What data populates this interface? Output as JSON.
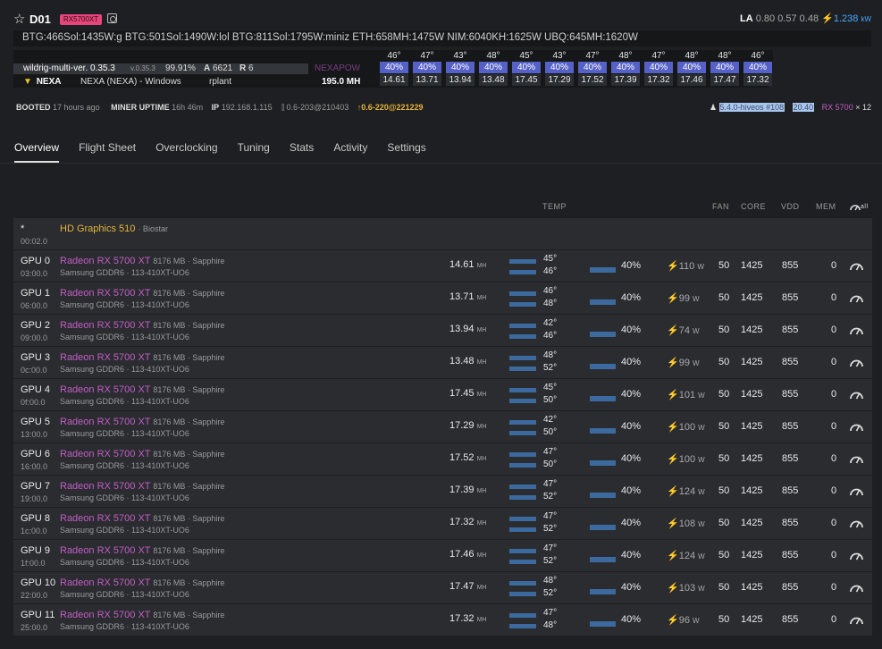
{
  "header": {
    "name": "D01",
    "tag": "RX5700XT",
    "la_label": "LA",
    "la_values": "0.80 0.57 0.48",
    "power": "1.238",
    "power_unit": "kW"
  },
  "algos": "BTG:466Sol:1435W:g BTG:501Sol:1490W:lol BTG:811Sol:1795W:miniz ETH:658MH:1475W NIM:6040KH:1625W UBQ:645MH:1620W",
  "miner": {
    "name": "wildrig-multi-ver. 0.35.3",
    "ver": "v.0.35.3",
    "accept": "99.91%",
    "a_label": "A",
    "a": "6621",
    "r_label": "R",
    "r": "6",
    "coin": "NEXA",
    "pool": "NEXA (NEXA) - Windows",
    "pool_host": "rplant",
    "algo": "NEXAPOW",
    "hashrate": "195.0 MH"
  },
  "gpu_strip": [
    {
      "t": "46°",
      "f": "40%",
      "h": "14.61"
    },
    {
      "t": "47°",
      "f": "40%",
      "h": "13.71"
    },
    {
      "t": "43°",
      "f": "40%",
      "h": "13.94"
    },
    {
      "t": "48°",
      "f": "40%",
      "h": "13.48"
    },
    {
      "t": "45°",
      "f": "40%",
      "h": "17.45"
    },
    {
      "t": "43°",
      "f": "40%",
      "h": "17.29"
    },
    {
      "t": "47°",
      "f": "40%",
      "h": "17.52"
    },
    {
      "t": "48°",
      "f": "40%",
      "h": "17.39"
    },
    {
      "t": "47°",
      "f": "40%",
      "h": "17.32"
    },
    {
      "t": "48°",
      "f": "40%",
      "h": "17.46"
    },
    {
      "t": "48°",
      "f": "40%",
      "h": "17.47"
    },
    {
      "t": "46°",
      "f": "40%",
      "h": "17.32"
    }
  ],
  "info": {
    "booted_label": "BOOTED",
    "booted": "17 hours ago",
    "uptime_label": "MINER UPTIME",
    "uptime": "16h 46m",
    "ip_label": "IP",
    "ip": "192.168.1.115",
    "hive": "0.6-203@210403",
    "upd": "0.6-220@221229",
    "kernel": "5.4.0-hiveos #108",
    "amd": "20.40",
    "rx": "RX 5700",
    "count": "× 12"
  },
  "tabs": [
    "Overview",
    "Flight Sheet",
    "Overclocking",
    "Tuning",
    "Stats",
    "Activity",
    "Settings"
  ],
  "headers": {
    "temp": "TEMP",
    "fan": "FAN",
    "core": "CORE",
    "vdd": "VDD",
    "mem": "MEM",
    "all": "all"
  },
  "igpu": {
    "id": "*",
    "bus": "00:02.0",
    "name": "HD Graphics 510",
    "vendor": "· Biostar"
  },
  "gpus": [
    {
      "id": "GPU 0",
      "bus": "03:00.0",
      "name": "Radeon RX 5700 XT",
      "spec": "8176 MB · Sapphire",
      "mem": "Samsung GDDR6 · 113-410XT-UO6",
      "hash": "14.61",
      "unit": "MH",
      "t1": "45°",
      "t2": "46°",
      "fan": "40%",
      "pwr": "110",
      "pu": "W",
      "fanv": "50",
      "core": "1425",
      "vdd": "855",
      "memv": "0"
    },
    {
      "id": "GPU 1",
      "bus": "06:00.0",
      "name": "Radeon RX 5700 XT",
      "spec": "8176 MB · Sapphire",
      "mem": "Samsung GDDR6 · 113-410XT-UO6",
      "hash": "13.71",
      "unit": "MH",
      "t1": "46°",
      "t2": "48°",
      "fan": "40%",
      "pwr": "99",
      "pu": "W",
      "fanv": "50",
      "core": "1425",
      "vdd": "855",
      "memv": "0"
    },
    {
      "id": "GPU 2",
      "bus": "09:00.0",
      "name": "Radeon RX 5700 XT",
      "spec": "8176 MB · Sapphire",
      "mem": "Samsung GDDR6 · 113-410XT-UO6",
      "hash": "13.94",
      "unit": "MH",
      "t1": "42°",
      "t2": "46°",
      "fan": "40%",
      "pwr": "74",
      "pu": "W",
      "fanv": "50",
      "core": "1425",
      "vdd": "855",
      "memv": "0"
    },
    {
      "id": "GPU 3",
      "bus": "0c:00.0",
      "name": "Radeon RX 5700 XT",
      "spec": "8176 MB · Sapphire",
      "mem": "Samsung GDDR6 · 113-410XT-UO6",
      "hash": "13.48",
      "unit": "MH",
      "t1": "48°",
      "t2": "52°",
      "fan": "40%",
      "pwr": "99",
      "pu": "W",
      "fanv": "50",
      "core": "1425",
      "vdd": "855",
      "memv": "0"
    },
    {
      "id": "GPU 4",
      "bus": "0f:00.0",
      "name": "Radeon RX 5700 XT",
      "spec": "8176 MB · Sapphire",
      "mem": "Samsung GDDR6 · 113-410XT-UO6",
      "hash": "17.45",
      "unit": "MH",
      "t1": "45°",
      "t2": "50°",
      "fan": "40%",
      "pwr": "101",
      "pu": "W",
      "fanv": "50",
      "core": "1425",
      "vdd": "855",
      "memv": "0"
    },
    {
      "id": "GPU 5",
      "bus": "13:00.0",
      "name": "Radeon RX 5700 XT",
      "spec": "8176 MB · Sapphire",
      "mem": "Samsung GDDR6 · 113-410XT-UO6",
      "hash": "17.29",
      "unit": "MH",
      "t1": "42°",
      "t2": "50°",
      "fan": "40%",
      "pwr": "100",
      "pu": "W",
      "fanv": "50",
      "core": "1425",
      "vdd": "855",
      "memv": "0"
    },
    {
      "id": "GPU 6",
      "bus": "16:00.0",
      "name": "Radeon RX 5700 XT",
      "spec": "8176 MB · Sapphire",
      "mem": "Samsung GDDR6 · 113-410XT-UO6",
      "hash": "17.52",
      "unit": "MH",
      "t1": "47°",
      "t2": "50°",
      "fan": "40%",
      "pwr": "100",
      "pu": "W",
      "fanv": "50",
      "core": "1425",
      "vdd": "855",
      "memv": "0"
    },
    {
      "id": "GPU 7",
      "bus": "19:00.0",
      "name": "Radeon RX 5700 XT",
      "spec": "8176 MB · Sapphire",
      "mem": "Samsung GDDR6 · 113-410XT-UO6",
      "hash": "17.39",
      "unit": "MH",
      "t1": "47°",
      "t2": "52°",
      "fan": "40%",
      "pwr": "124",
      "pu": "W",
      "fanv": "50",
      "core": "1425",
      "vdd": "855",
      "memv": "0"
    },
    {
      "id": "GPU 8",
      "bus": "1c:00.0",
      "name": "Radeon RX 5700 XT",
      "spec": "8176 MB · Sapphire",
      "mem": "Samsung GDDR6 · 113-410XT-UO6",
      "hash": "17.32",
      "unit": "MH",
      "t1": "47°",
      "t2": "52°",
      "fan": "40%",
      "pwr": "108",
      "pu": "W",
      "fanv": "50",
      "core": "1425",
      "vdd": "855",
      "memv": "0"
    },
    {
      "id": "GPU 9",
      "bus": "1f:00.0",
      "name": "Radeon RX 5700 XT",
      "spec": "8176 MB · Sapphire",
      "mem": "Samsung GDDR6 · 113-410XT-UO6",
      "hash": "17.46",
      "unit": "MH",
      "t1": "47°",
      "t2": "52°",
      "fan": "40%",
      "pwr": "124",
      "pu": "W",
      "fanv": "50",
      "core": "1425",
      "vdd": "855",
      "memv": "0"
    },
    {
      "id": "GPU 10",
      "bus": "22:00.0",
      "name": "Radeon RX 5700 XT",
      "spec": "8176 MB · Sapphire",
      "mem": "Samsung GDDR6 · 113-410XT-UO6",
      "hash": "17.47",
      "unit": "MH",
      "t1": "48°",
      "t2": "52°",
      "fan": "40%",
      "pwr": "103",
      "pu": "W",
      "fanv": "50",
      "core": "1425",
      "vdd": "855",
      "memv": "0"
    },
    {
      "id": "GPU 11",
      "bus": "25:00.0",
      "name": "Radeon RX 5700 XT",
      "spec": "8176 MB · Sapphire",
      "mem": "Samsung GDDR6 · 113-410XT-UO6",
      "hash": "17.32",
      "unit": "MH",
      "t1": "47°",
      "t2": "48°",
      "fan": "40%",
      "pwr": "96",
      "pu": "W",
      "fanv": "50",
      "core": "1425",
      "vdd": "855",
      "memv": "0"
    }
  ]
}
